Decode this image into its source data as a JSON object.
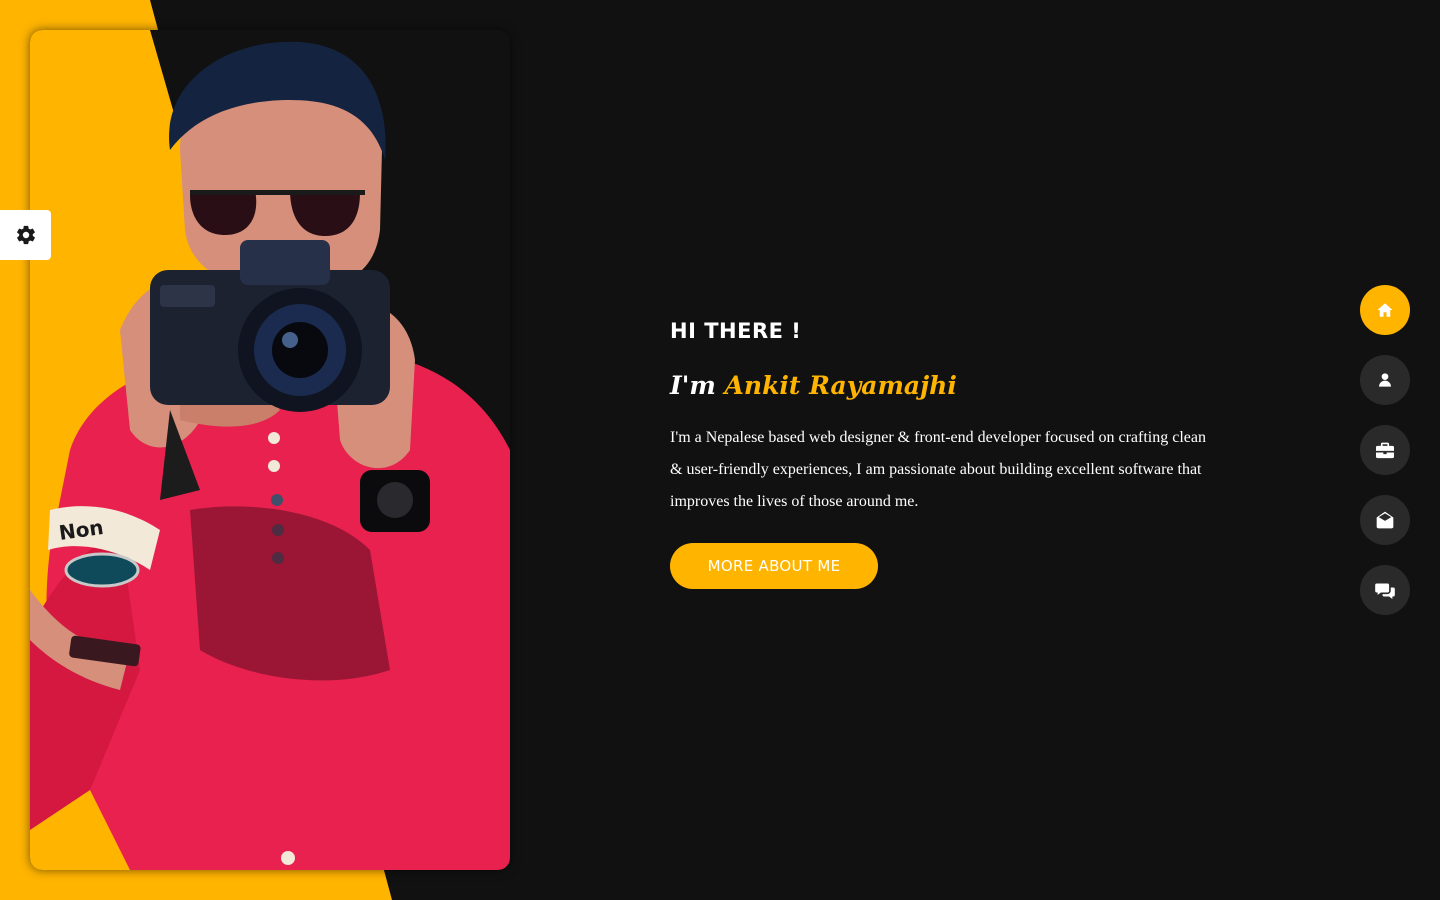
{
  "hero": {
    "greeting": "HI THERE !",
    "intro_prefix": "I'm",
    "name": "Ankit Rayamajhi",
    "bio": "I'm a Nepalese based web designer & front-end developer focused on crafting clean & user-friendly experiences, I am passionate about building excellent software that improves the lives of those around me.",
    "button_label": "MORE ABOUT ME"
  },
  "nav": {
    "items": [
      {
        "icon": "home-icon",
        "active": true
      },
      {
        "icon": "user-icon",
        "active": false
      },
      {
        "icon": "briefcase-icon",
        "active": false
      },
      {
        "icon": "envelope-open-icon",
        "active": false
      },
      {
        "icon": "comments-icon",
        "active": false
      }
    ]
  },
  "settings": {
    "icon": "gear-icon"
  },
  "colors": {
    "accent": "#ffb400",
    "background": "#111111",
    "nav_button": "#2b2a2a",
    "shirt": "#e8214e"
  }
}
